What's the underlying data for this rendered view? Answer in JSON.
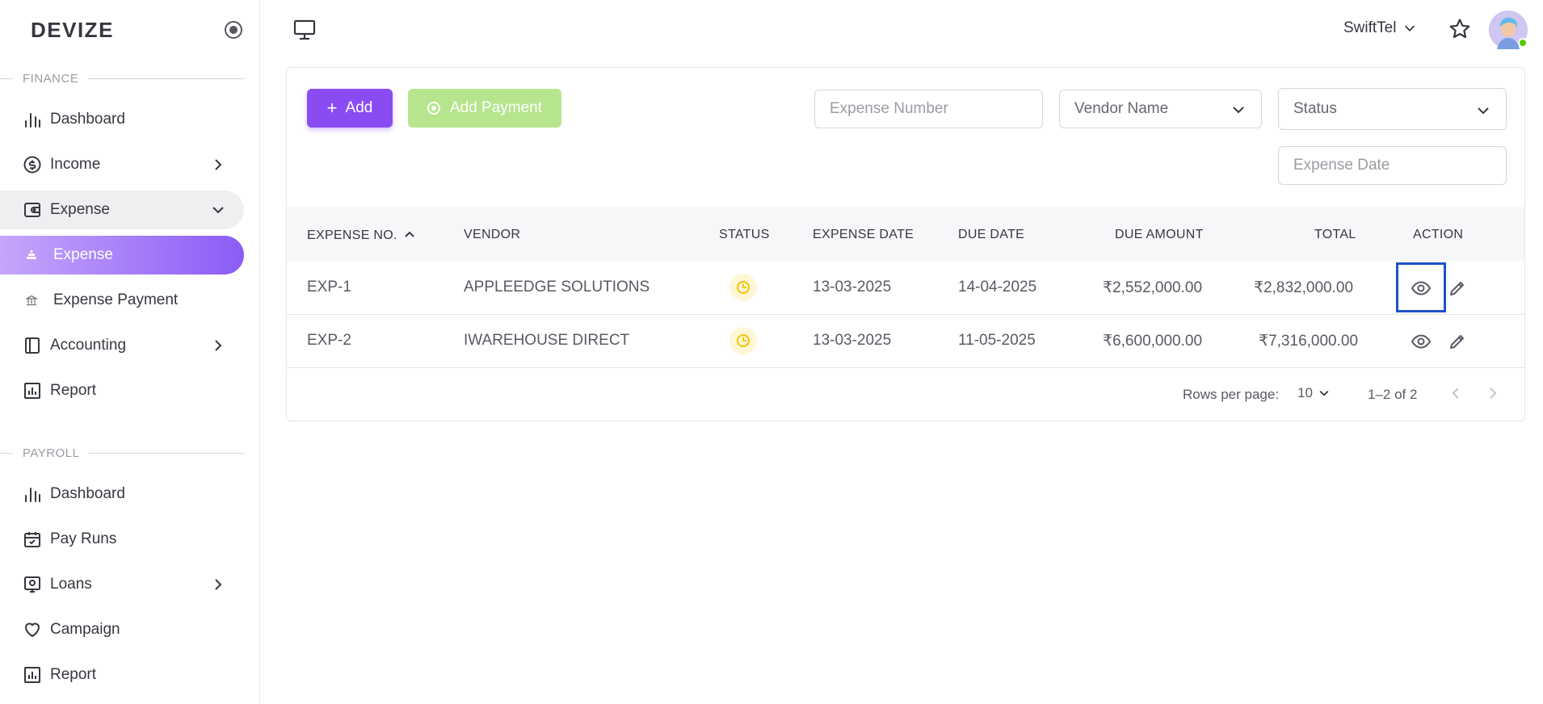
{
  "brand": {
    "name": "DEVIZE"
  },
  "sidebar": {
    "finance_label": "FINANCE",
    "payroll_label": "PAYROLL",
    "finance_items": [
      {
        "label": "Dashboard",
        "icon": "bar-chart-icon"
      },
      {
        "label": "Income",
        "icon": "currency-icon"
      },
      {
        "label": "Expense",
        "icon": "wallet-icon"
      },
      {
        "label": "Expense",
        "icon": "sub-item-icon"
      },
      {
        "label": "Expense Payment",
        "icon": "bank-icon"
      },
      {
        "label": "Accounting",
        "icon": "book-icon"
      },
      {
        "label": "Report",
        "icon": "report-icon"
      }
    ],
    "payroll_items": [
      {
        "label": "Dashboard",
        "icon": "bar-chart-icon"
      },
      {
        "label": "Pay Runs",
        "icon": "calendar-icon"
      },
      {
        "label": "Loans",
        "icon": "loan-icon"
      },
      {
        "label": "Campaign",
        "icon": "heart-icon"
      },
      {
        "label": "Report",
        "icon": "report-icon"
      }
    ]
  },
  "topbar": {
    "company": "SwiftTel"
  },
  "toolbar": {
    "add_label": "Add",
    "add_payment_label": "Add Payment",
    "expense_number_placeholder": "Expense Number",
    "vendor_name_label": "Vendor Name",
    "status_label": "Status",
    "expense_date_placeholder": "Expense Date"
  },
  "table": {
    "columns": [
      "EXPENSE NO.",
      "VENDOR",
      "STATUS",
      "EXPENSE DATE",
      "DUE DATE",
      "DUE AMOUNT",
      "TOTAL",
      "ACTION"
    ],
    "rows": [
      {
        "no": "EXP-1",
        "vendor": "APPLEEDGE SOLUTIONS",
        "status": "pending",
        "expense_date": "13-03-2025",
        "due_date": "14-04-2025",
        "due_amount": "₹2,552,000.00",
        "total": "₹2,832,000.00"
      },
      {
        "no": "EXP-2",
        "vendor": "IWAREHOUSE DIRECT",
        "status": "pending",
        "expense_date": "13-03-2025",
        "due_date": "11-05-2025",
        "due_amount": "₹6,600,000.00",
        "total": "₹7,316,000.00"
      }
    ]
  },
  "pagination": {
    "rows_per_page_label": "Rows per page:",
    "rows_per_page_value": "10",
    "range": "1–2 of 2"
  },
  "colors": {
    "primary": "#8a4cf2",
    "add_payment_disabled": "#b6e58d",
    "status_pending": "#f5c400",
    "highlight": "#1c52c9"
  }
}
